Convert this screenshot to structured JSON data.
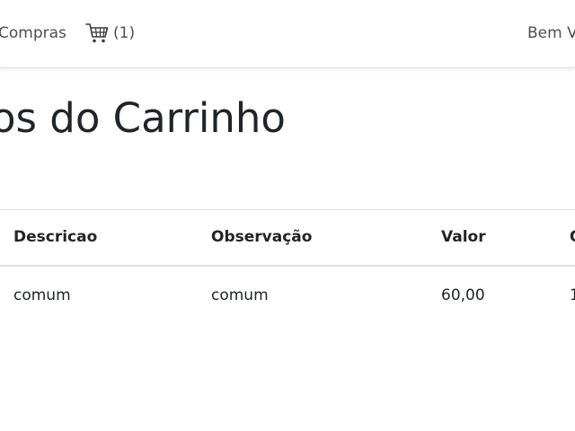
{
  "navbar": {
    "compras_label": "Compras",
    "cart_icon": "shopping-cart-icon",
    "cart_count": "(1)",
    "greeting": "Bem V"
  },
  "page": {
    "title": "os do Carrinho"
  },
  "table": {
    "headers": [
      "Descricao",
      "Observação",
      "Valor",
      "Q"
    ],
    "rows": [
      [
        "comum",
        "comum",
        "60,00",
        "1"
      ]
    ]
  }
}
